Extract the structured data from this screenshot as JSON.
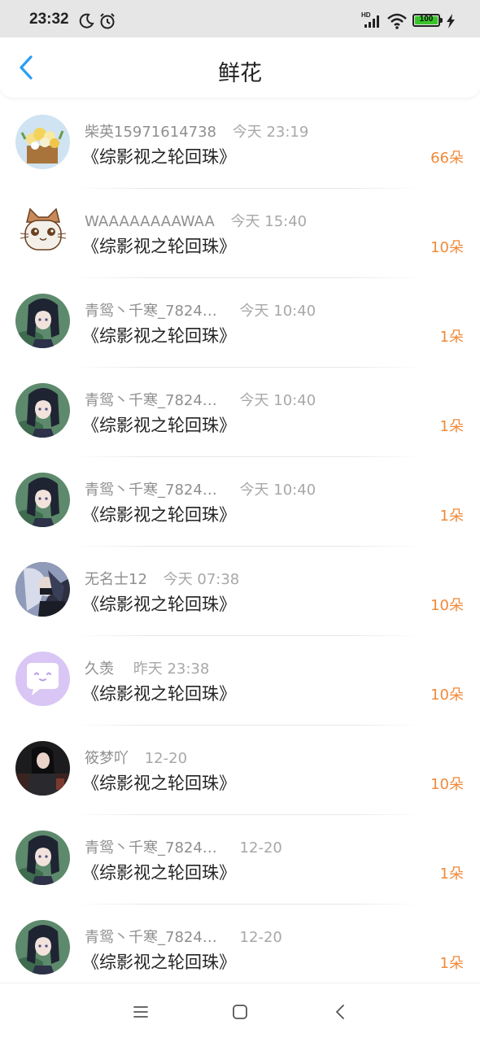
{
  "status_bar": {
    "time": "23:32",
    "icons": [
      "moon-icon",
      "alarm-icon",
      "signal-icon",
      "wifi-icon",
      "battery-icon",
      "charging-icon"
    ],
    "network_badge": "HD",
    "battery": "100",
    "battery_color": "#39c42a"
  },
  "header": {
    "title": "鲜花",
    "back_icon": "chevron-left-icon",
    "accent_color": "#2a9df4"
  },
  "colors": {
    "count": "#f08a3a",
    "name": "#8f8f8f",
    "book": "#222222"
  },
  "items": [
    {
      "name": "柴英15971614738",
      "time": "今天 23:19",
      "book": "《综影视之轮回珠》",
      "count": "66朵",
      "avatar": "flower-basket"
    },
    {
      "name": "WAAAAAAAAWAA",
      "time": "今天 15:40",
      "book": "《综影视之轮回珠》",
      "count": "10朵",
      "avatar": "cartoon-cat"
    },
    {
      "name": "青鸳丶千寒_7824…",
      "time": "今天 10:40",
      "book": "《综影视之轮回珠》",
      "count": "1朵",
      "avatar": "anime-girl"
    },
    {
      "name": "青鸳丶千寒_7824…",
      "time": "今天 10:40",
      "book": "《综影视之轮回珠》",
      "count": "1朵",
      "avatar": "anime-girl"
    },
    {
      "name": "青鸳丶千寒_7824…",
      "time": "今天 10:40",
      "book": "《综影视之轮回珠》",
      "count": "1朵",
      "avatar": "anime-girl"
    },
    {
      "name": "无名士12",
      "time": "今天 07:38",
      "book": "《综影视之轮回珠》",
      "count": "10朵",
      "avatar": "masked-character"
    },
    {
      "name": "久羡",
      "time": "昨天 23:38",
      "book": "《综影视之轮回珠》",
      "count": "10朵",
      "avatar": "chat-bubble"
    },
    {
      "name": "筱梦吖",
      "time": "12-20",
      "book": "《综影视之轮回珠》",
      "count": "10朵",
      "avatar": "dark-portrait"
    },
    {
      "name": "青鸳丶千寒_7824…",
      "time": "12-20",
      "book": "《综影视之轮回珠》",
      "count": "1朵",
      "avatar": "anime-girl"
    },
    {
      "name": "青鸳丶千寒_7824…",
      "time": "12-20",
      "book": "《综影视之轮回珠》",
      "count": "1朵",
      "avatar": "anime-girl"
    }
  ],
  "nav_bar": {
    "buttons": [
      "menu-icon",
      "home-icon",
      "back-icon"
    ]
  }
}
